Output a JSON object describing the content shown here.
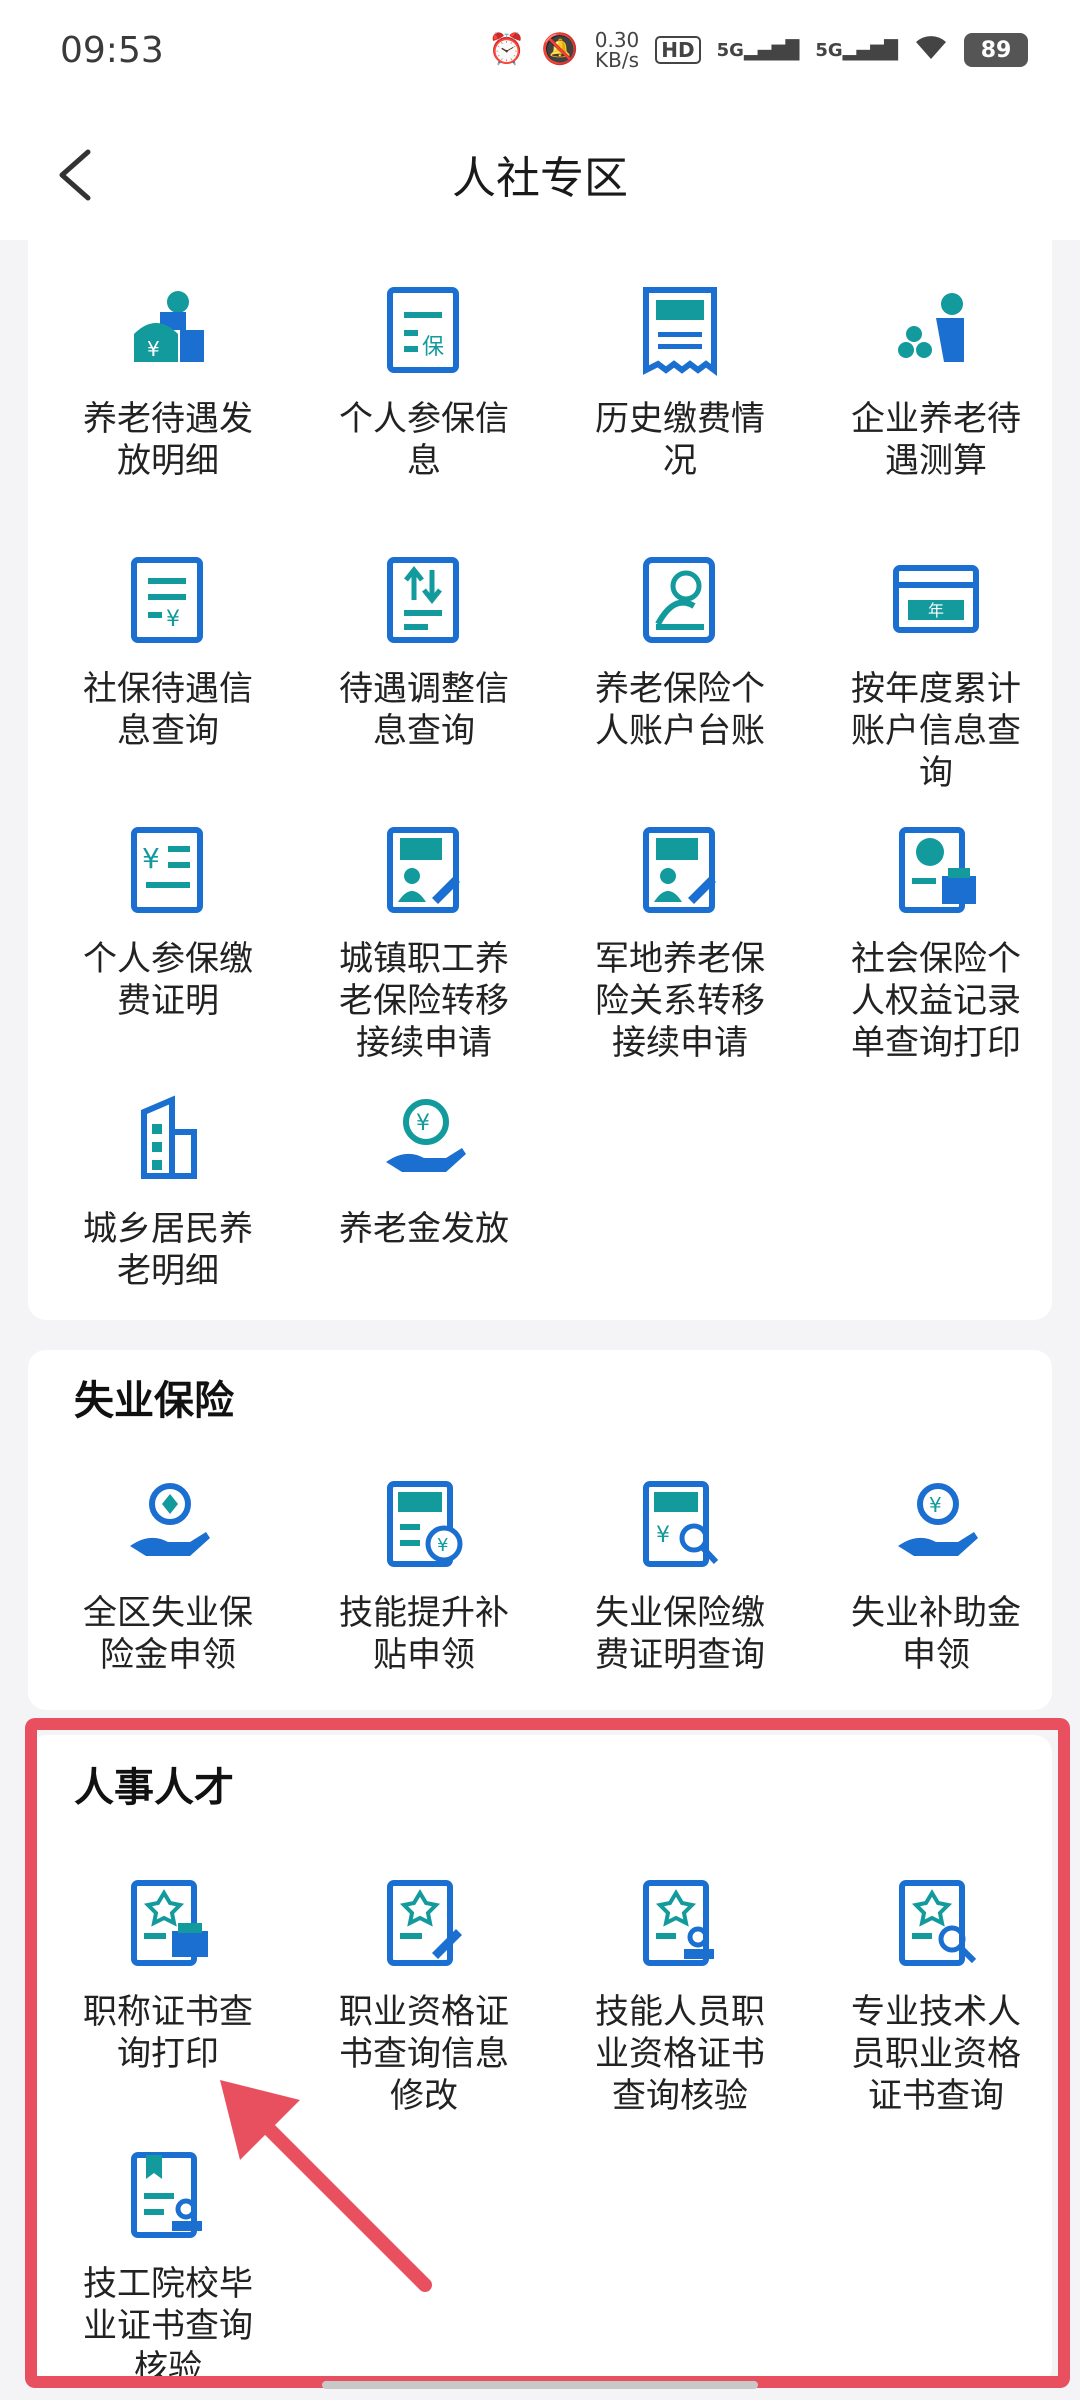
{
  "status": {
    "time": "09:53",
    "net_speed_value": "0.30",
    "net_speed_unit": "KB/s",
    "hd": "HD",
    "signal1": "5G",
    "signal2": "5G",
    "battery": "89"
  },
  "header": {
    "title": "人社专区"
  },
  "pension": {
    "items": [
      {
        "label": "养老待遇发放明细",
        "icon": "person-yuan-icon"
      },
      {
        "label": "个人参保信息",
        "icon": "document-bao-icon"
      },
      {
        "label": "历史缴费情况",
        "icon": "receipt-jiaofei-icon"
      },
      {
        "label": "企业养老待遇测算",
        "icon": "person-calc-icon"
      },
      {
        "label": "社保待遇信息查询",
        "icon": "document-yuan-icon"
      },
      {
        "label": "待遇调整信息查询",
        "icon": "document-arrows-icon"
      },
      {
        "label": "养老保险个人账户台账",
        "icon": "account-person-icon"
      },
      {
        "label": "按年度累计账户信息查询",
        "icon": "card-year-icon"
      },
      {
        "label": "个人参保缴费证明",
        "icon": "document-yuan-list-icon"
      },
      {
        "label": "城镇职工养老保险转移接续申请",
        "icon": "document-chengzhen-icon"
      },
      {
        "label": "军地养老保险关系转移接续申请",
        "icon": "document-jundi-icon"
      },
      {
        "label": "社会保险个人权益记录单查询打印",
        "icon": "document-si-print-icon"
      },
      {
        "label": "城乡居民养老明细",
        "icon": "building-icon"
      },
      {
        "label": "养老金发放",
        "icon": "hand-coin-icon"
      }
    ]
  },
  "unemployment": {
    "title": "失业保险",
    "items": [
      {
        "label": "全区失业保险金申领",
        "icon": "hand-coin-icon"
      },
      {
        "label": "技能提升补贴申领",
        "icon": "document-jineng-icon"
      },
      {
        "label": "失业保险缴费证明查询",
        "icon": "document-shiye-search-icon"
      },
      {
        "label": "失业补助金申领",
        "icon": "hand-coin-alt-icon"
      }
    ]
  },
  "talent": {
    "title": "人事人才",
    "items": [
      {
        "label": "职称证书查询打印",
        "icon": "certificate-print-icon"
      },
      {
        "label": "职业资格证书查询信息修改",
        "icon": "certificate-edit-icon"
      },
      {
        "label": "技能人员职业资格证书查询核验",
        "icon": "certificate-stamp-icon"
      },
      {
        "label": "专业技术人员职业资格证书查询",
        "icon": "certificate-search-icon"
      },
      {
        "label": "技工院校毕业证书查询核验",
        "icon": "certificate-bookmark-icon"
      }
    ]
  },
  "colors": {
    "teal": "#139a9c",
    "blue": "#1a6fd0",
    "highlight": "#e8505f"
  }
}
